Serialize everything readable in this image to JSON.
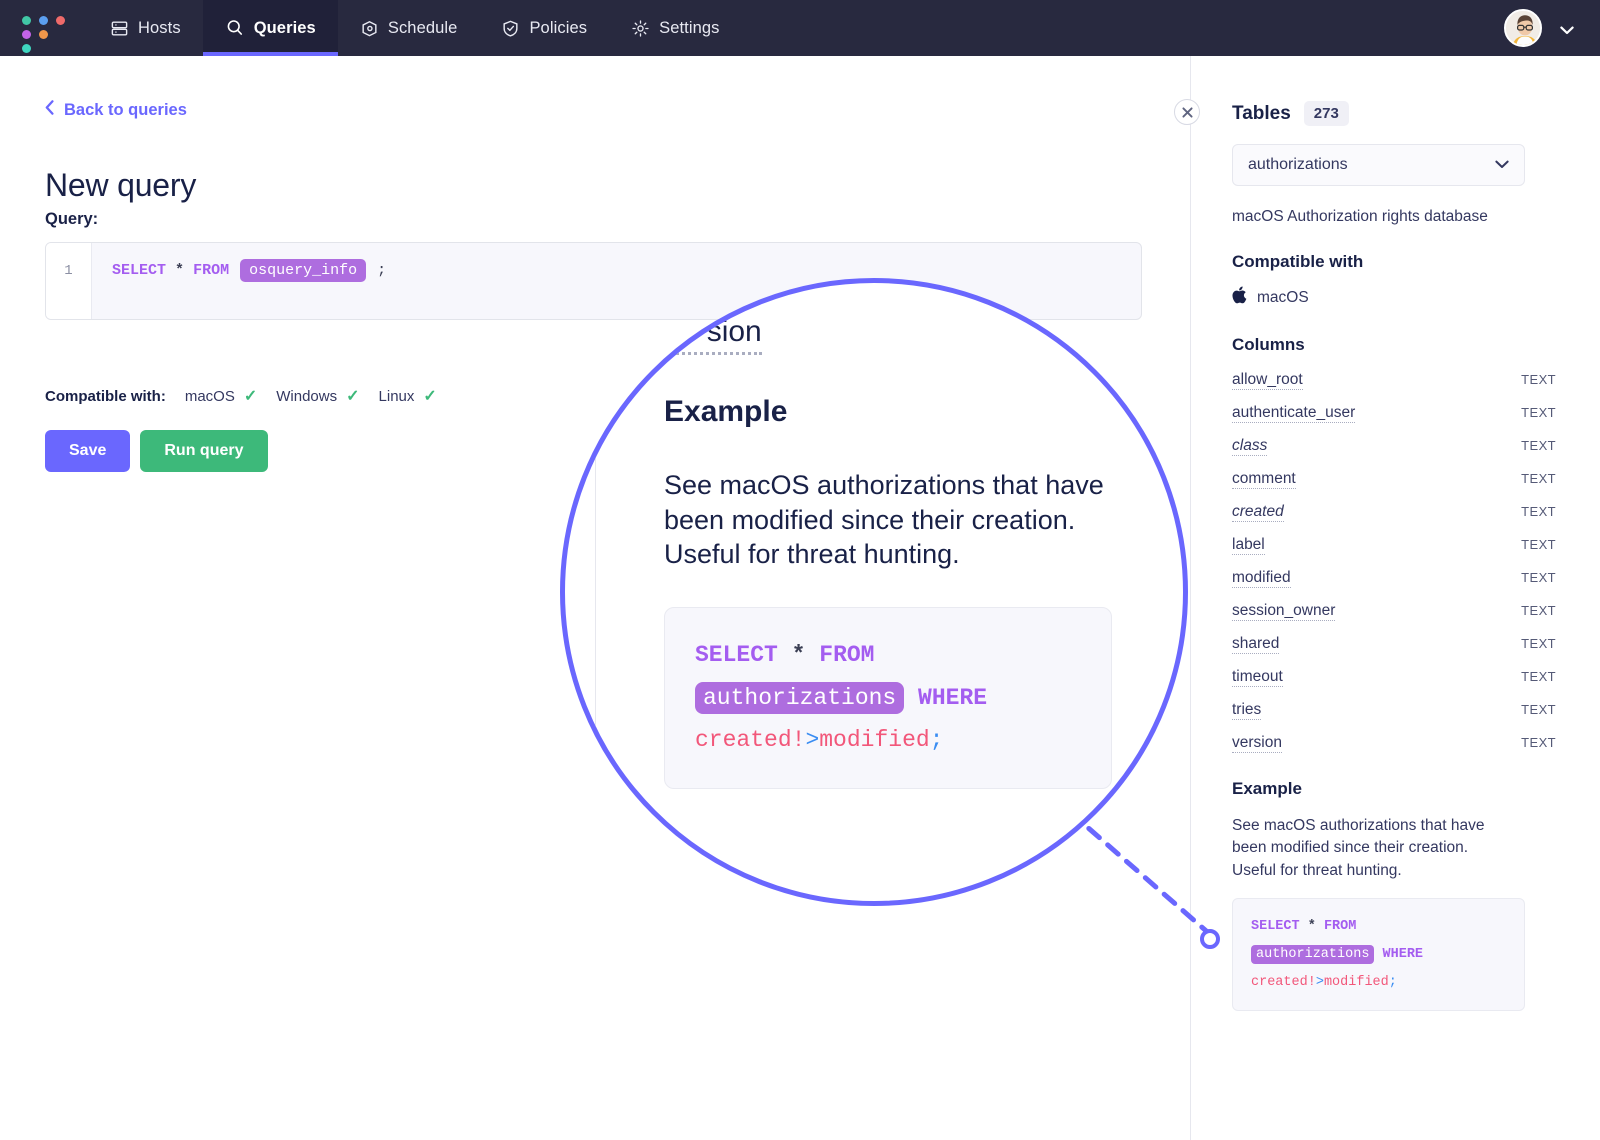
{
  "topnav": {
    "logo_name": "fleet-logo",
    "logo_dots": [
      "#41c7a5",
      "#5b9ff0",
      "#ef6a6a",
      "#c463e8",
      "#f0964a",
      "#3fd6c0"
    ],
    "items": [
      {
        "label": "Hosts",
        "icon": "server-icon",
        "active": false
      },
      {
        "label": "Queries",
        "icon": "search-circle-icon",
        "active": true
      },
      {
        "label": "Schedule",
        "icon": "calendar-box-icon",
        "active": false
      },
      {
        "label": "Policies",
        "icon": "shield-check-icon",
        "active": false
      },
      {
        "label": "Settings",
        "icon": "gear-icon",
        "active": false
      }
    ],
    "avatar_alt": "user-avatar",
    "caret_icon": "chevron-down-icon",
    "active_underline_color": "#6a67fe",
    "background_color": "#28293f"
  },
  "main": {
    "back_link": "Back to queries",
    "back_icon": "chevron-left-icon",
    "page_title": "New query",
    "query_label": "Query:",
    "editor": {
      "line_number": "1",
      "tokens": {
        "select": "SELECT",
        "star": "*",
        "from": "FROM",
        "table": "osquery_info",
        "semicolon": ";"
      }
    },
    "compatible_label": "Compatible with:",
    "compatible_os": [
      {
        "name": "macOS",
        "supported": true
      },
      {
        "name": "Windows",
        "supported": true
      },
      {
        "name": "Linux",
        "supported": true
      }
    ],
    "check_glyph": "✓",
    "check_color": "#3db97a",
    "buttons": {
      "save_label": "Save",
      "save_color": "#6a67fe",
      "run_label": "Run query",
      "run_color": "#3db97a"
    }
  },
  "sidebar": {
    "close_label": "×",
    "tables_title": "Tables",
    "tables_count": "273",
    "selected_table": "authorizations",
    "select_caret_icon": "chevron-down-icon",
    "table_description": "macOS Authorization rights database",
    "compatible_heading": "Compatible with",
    "compatible_os": "macOS",
    "compatible_icon": "apple-icon",
    "columns_heading": "Columns",
    "columns": [
      {
        "name": "allow_root",
        "type": "TEXT",
        "italic": false
      },
      {
        "name": "authenticate_user",
        "type": "TEXT",
        "italic": false
      },
      {
        "name": "class",
        "type": "TEXT",
        "italic": true
      },
      {
        "name": "comment",
        "type": "TEXT",
        "italic": false
      },
      {
        "name": "created",
        "type": "TEXT",
        "italic": true
      },
      {
        "name": "label",
        "type": "TEXT",
        "italic": false
      },
      {
        "name": "modified",
        "type": "TEXT",
        "italic": false
      },
      {
        "name": "session_owner",
        "type": "TEXT",
        "italic": false
      },
      {
        "name": "shared",
        "type": "TEXT",
        "italic": false
      },
      {
        "name": "timeout",
        "type": "TEXT",
        "italic": false
      },
      {
        "name": "tries",
        "type": "TEXT",
        "italic": false
      },
      {
        "name": "version",
        "type": "TEXT",
        "italic": false
      }
    ],
    "example_heading": "Example",
    "example_text": "See macOS authorizations that have been modified since their creation. Useful for threat hunting.",
    "example_code": {
      "select": "SELECT",
      "star": "*",
      "from": "FROM",
      "table": "authorizations",
      "where": "WHERE",
      "left_operand": "created",
      "bang": "!",
      "gt": ">",
      "right_operand": "modified",
      "semicolon": ";"
    }
  },
  "magnifier": {
    "partial_column": "version",
    "example_heading": "Example",
    "example_text": "See macOS authorizations that have been modified since their creation. Useful for threat hunting.",
    "code": {
      "select": "SELECT",
      "star": "*",
      "from": "FROM",
      "table": "authorizations",
      "where": "WHERE",
      "left_operand": "created",
      "bang": "!",
      "gt": ">",
      "right_operand": "modified",
      "semicolon": ";"
    },
    "ring_color": "#6a67fe"
  }
}
